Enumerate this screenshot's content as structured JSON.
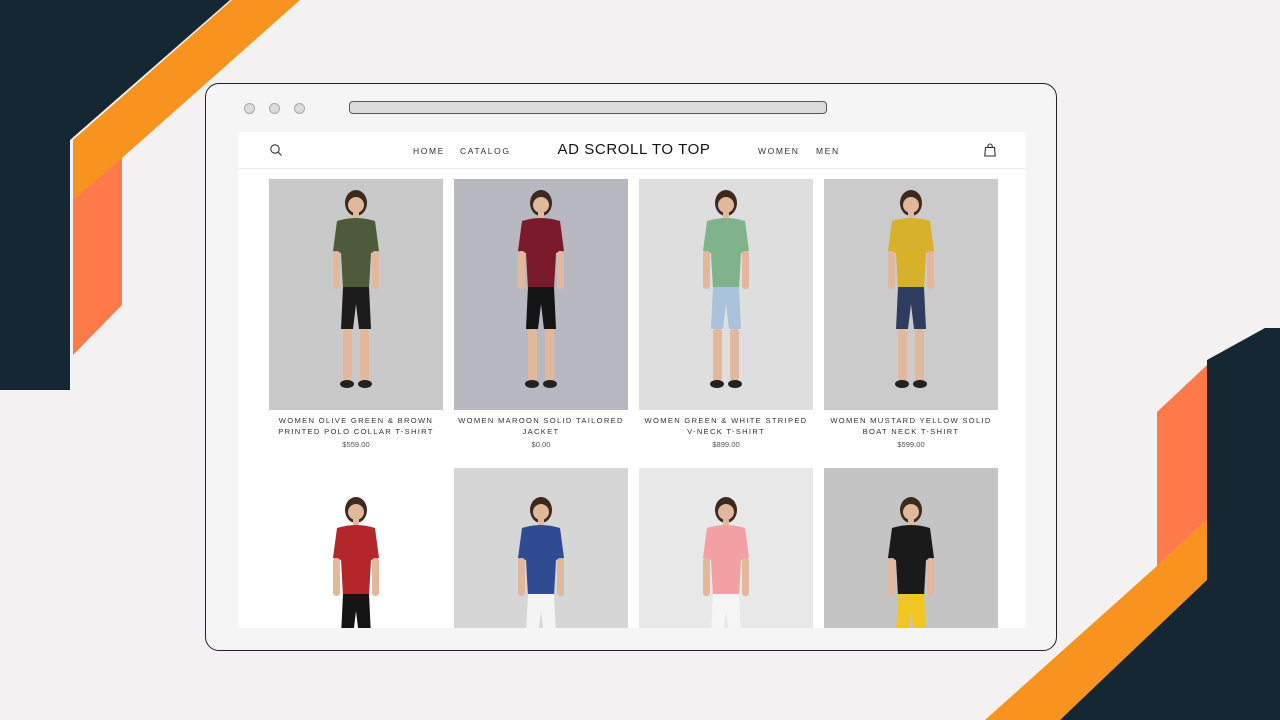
{
  "colors": {
    "navy": "#152733",
    "orange": "#f7931e",
    "coral": "#ff7a4a",
    "background": "#f3f1f2"
  },
  "header": {
    "brand": "AD SCROLL TO TOP",
    "nav_left": [
      "HOME",
      "CATALOG"
    ],
    "nav_right": [
      "WOMEN",
      "MEN"
    ],
    "search_icon": "search-icon",
    "cart_icon": "shopping-bag-icon"
  },
  "products": [
    {
      "name": "WOMEN OLIVE GREEN & BROWN PRINTED POLO COLLAR T-SHIRT",
      "price": "$559.00",
      "top": "#4e5a3a",
      "bottom": "#1c1c1c",
      "backdrop": "#c9c9c9"
    },
    {
      "name": "WOMEN MAROON SOLID TAILORED JACKET",
      "price": "$0.00",
      "top": "#7a1a2a",
      "bottom": "#141414",
      "backdrop": "#b8b8c0"
    },
    {
      "name": "WOMEN GREEN & WHITE STRIPED V-NECK T-SHIRT",
      "price": "$899.00",
      "top": "#7fb38c",
      "bottom": "#a9c3dc",
      "backdrop": "#dedede"
    },
    {
      "name": "WOMEN MUSTARD YELLOW SOLID BOAT NECK T-SHIRT",
      "price": "$599.00",
      "top": "#d8b12a",
      "bottom": "#2e3d5e",
      "backdrop": "#cbcbcb"
    },
    {
      "name": "",
      "price": "",
      "top": "#b3272b",
      "bottom": "#141414",
      "backdrop": "#ffffff"
    },
    {
      "name": "",
      "price": "",
      "top": "#2f4c93",
      "bottom": "#f4f4f4",
      "backdrop": "#d6d6d6"
    },
    {
      "name": "",
      "price": "",
      "top": "#f2a0a3",
      "bottom": "#f6f6f6",
      "backdrop": "#e8e8e8"
    },
    {
      "name": "",
      "price": "",
      "top": "#1a1a1a",
      "bottom": "#f2c622",
      "backdrop": "#c4c4c4"
    }
  ],
  "scroll_top_icon": "arrow-up-icon"
}
